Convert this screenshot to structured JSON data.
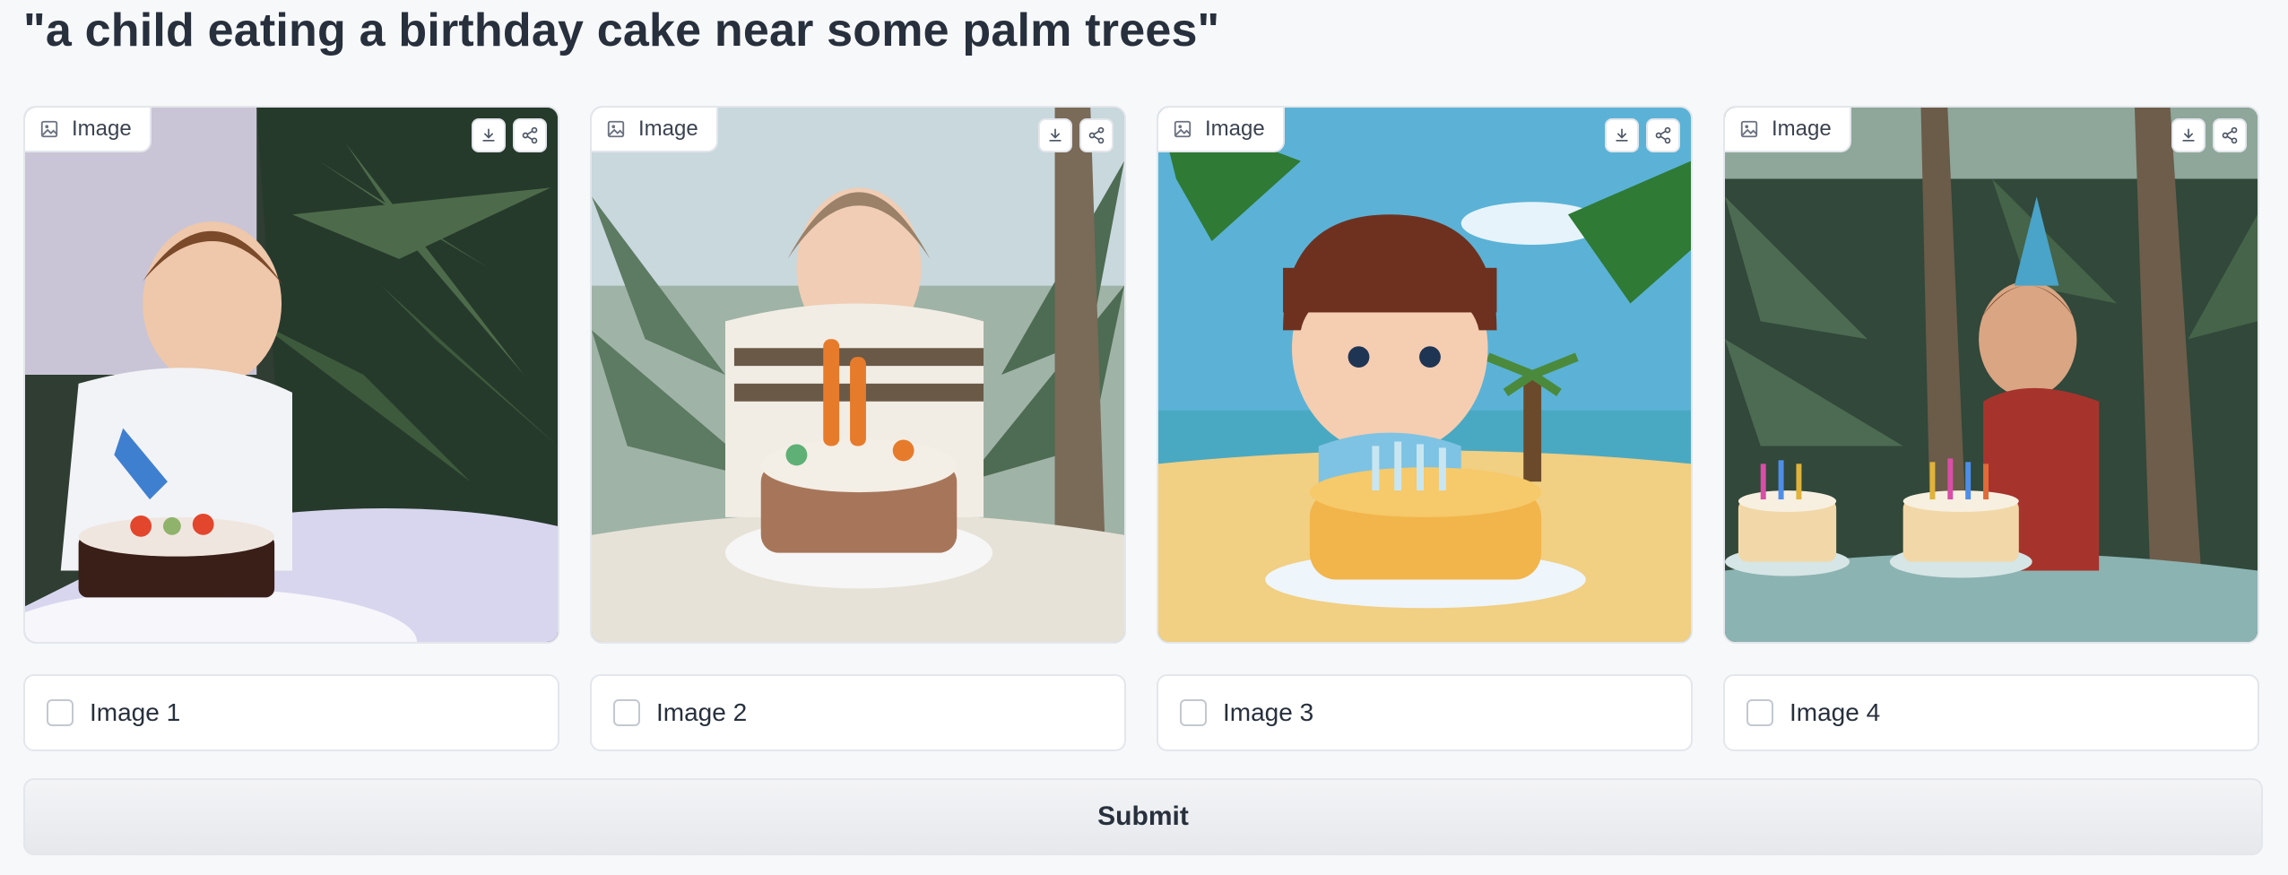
{
  "prompt": "\"a child eating a birthday cake near some palm trees\"",
  "gallery": {
    "items": [
      {
        "label": "Image",
        "checkbox_label": "Image 1",
        "checked": false
      },
      {
        "label": "Image",
        "checkbox_label": "Image 2",
        "checked": false
      },
      {
        "label": "Image",
        "checkbox_label": "Image 3",
        "checked": false
      },
      {
        "label": "Image",
        "checkbox_label": "Image 4",
        "checked": false
      }
    ],
    "icons": {
      "label": "image-icon",
      "download": "download-icon",
      "share": "share-icon"
    }
  },
  "submit_label": "Submit",
  "colors": {
    "page_bg": "#f7f8fa",
    "border": "#e3e6eb",
    "text": "#27303c"
  }
}
